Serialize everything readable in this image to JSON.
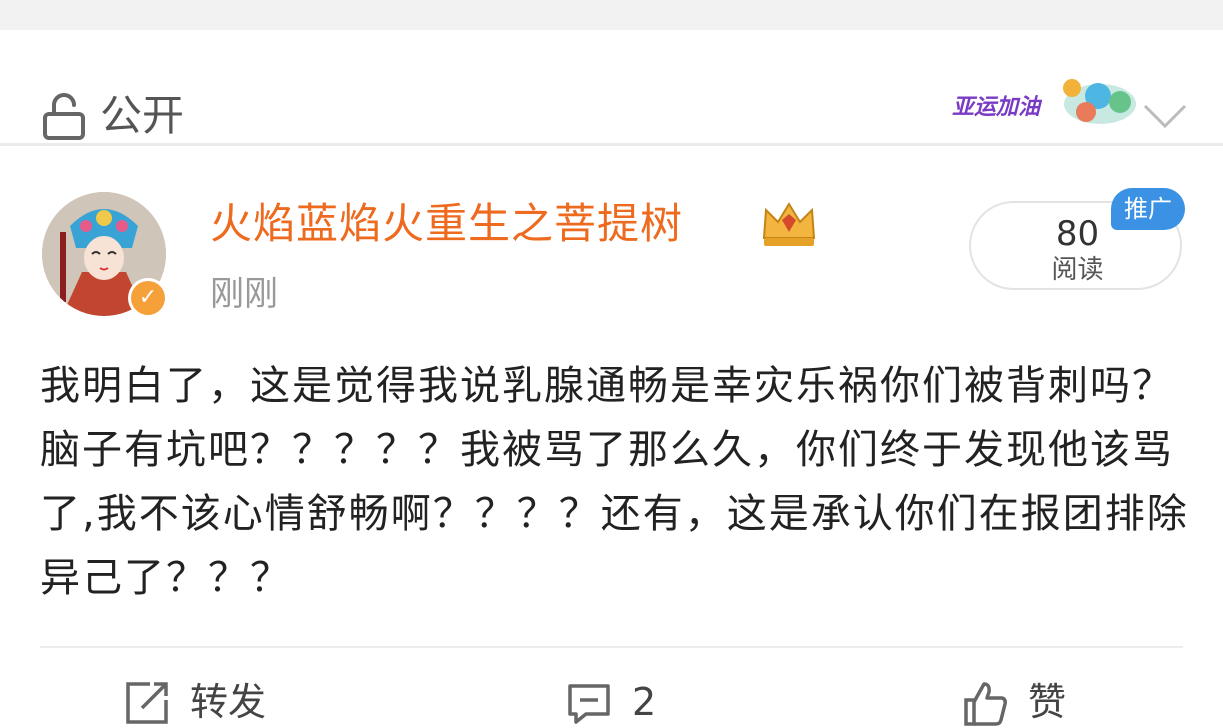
{
  "visibility": {
    "icon": "lock-open-icon",
    "label": "公开",
    "banner_text": "亚运加油",
    "expand_icon": "chevron-down-icon"
  },
  "post": {
    "author": "火焰蓝焰火重生之菩提树",
    "time": "刚刚",
    "badges": {
      "verified_icon": "verified-icon",
      "member_icon": "crown-icon"
    },
    "read_count": "80",
    "read_label": "阅读",
    "promo_label": "推广",
    "text": "我明白了，这是觉得我说乳腺通畅是幸灾乐祸你们被背刺吗？脑子有坑吧？？？？？我被骂了那么久，你们终于发现他该骂了,我不该心情舒畅啊？？？？还有，这是承认你们在报团排除异己了？？？"
  },
  "actions": {
    "repost": {
      "icon": "share-icon",
      "label": "转发"
    },
    "comment": {
      "icon": "comment-icon",
      "label": "2"
    },
    "like": {
      "icon": "thumbs-up-icon",
      "label": "赞"
    }
  },
  "colors": {
    "username": "#ee6a1e",
    "promo_badge": "#3b92e4",
    "verified": "#f6a03a",
    "banner_text": "#7a3bc4"
  }
}
